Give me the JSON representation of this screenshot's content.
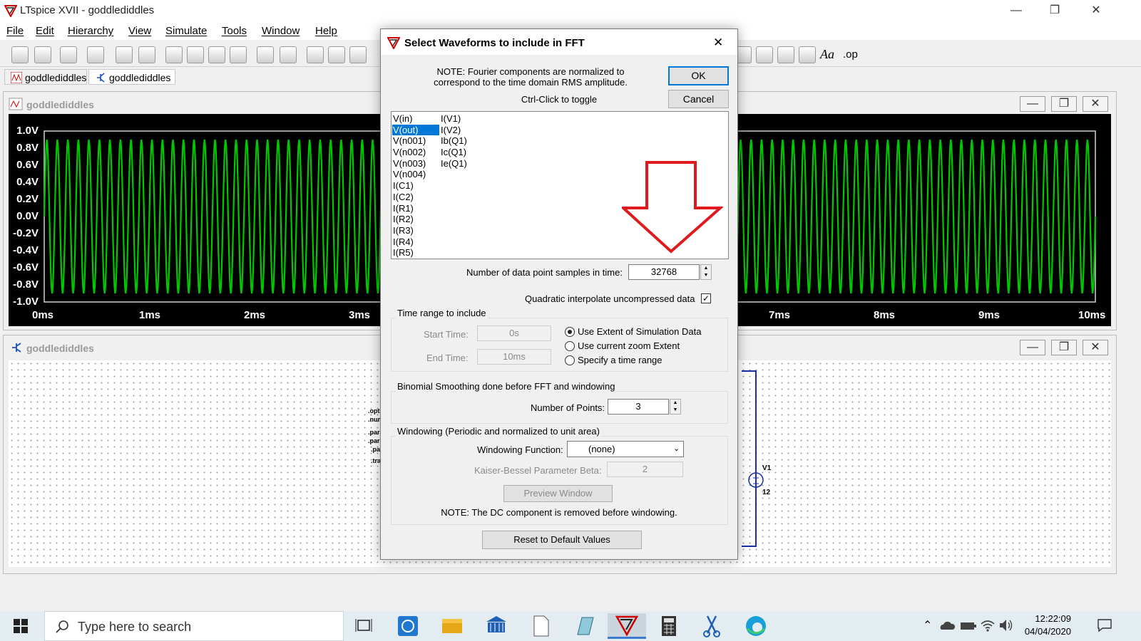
{
  "app": {
    "title": "LTspice XVII - goddlediddles",
    "colors": {
      "trace": "#00c800",
      "plot_bg": "#000000",
      "arrow": "#e0191e",
      "selection": "#0078d7"
    }
  },
  "window_controls": {
    "minimize": "—",
    "restore": "❐",
    "close": "✕"
  },
  "menu": [
    "File",
    "Edit",
    "Hierarchy",
    "View",
    "Simulate",
    "Tools",
    "Window",
    "Help"
  ],
  "toolbar": {
    "right_icons": [
      "Aa",
      ".op"
    ]
  },
  "tabs": [
    {
      "label": "goddlediddles",
      "icon": "waveform-icon"
    },
    {
      "label": "goddlediddles",
      "icon": "schematic-icon"
    }
  ],
  "plot_window": {
    "title": "goddlediddles",
    "y_ticks": [
      "1.0V",
      "0.8V",
      "0.6V",
      "0.4V",
      "0.2V",
      "0.0V",
      "-0.2V",
      "-0.4V",
      "-0.6V",
      "-0.8V",
      "-1.0V"
    ],
    "x_ticks": [
      "0ms",
      "1ms",
      "2ms",
      "3ms",
      "7ms",
      "8ms",
      "9ms",
      "10ms"
    ],
    "controls": [
      "—",
      "❐",
      "✕"
    ]
  },
  "chart_data": {
    "type": "line",
    "series": [
      {
        "amplitude_V": 0.9,
        "cycles_shown": 100
      }
    ],
    "x_range_ms": [
      0,
      10
    ],
    "ylim": [
      -1.0,
      1.0
    ],
    "grid": false
  },
  "schematic_window": {
    "title": "goddlediddles",
    "directives": [
      ".optio",
      ".numd",
      ".para",
      ".para",
      ".para",
      ".tran"
    ],
    "component_labels": [
      "V1",
      "12"
    ],
    "controls": [
      "—",
      "❐",
      "✕"
    ]
  },
  "dialog": {
    "title": "Select Waveforms to include in FFT",
    "close": "✕",
    "note_line1": "NOTE:  Fourier components are normalized to",
    "note_line2": "correspond to the time domain RMS amplitude.",
    "toggle_hint": "Ctrl-Click to toggle",
    "ok": "OK",
    "cancel": "Cancel",
    "waveforms_col1": [
      "V(in)",
      "V(out)",
      "V(n001)",
      "V(n002)",
      "V(n003)",
      "V(n004)",
      "I(C1)",
      "I(C2)",
      "I(R1)",
      "I(R2)",
      "I(R3)",
      "I(R4)",
      "I(R5)"
    ],
    "waveforms_col2": [
      "I(V1)",
      "I(V2)",
      "Ib(Q1)",
      "Ic(Q1)",
      "Ie(Q1)"
    ],
    "selected": "V(out)",
    "samples_label": "Number of data point samples in time:",
    "samples_value": "32768",
    "quadratic_label": "Quadratic interpolate uncompressed data",
    "quadratic_checked": true,
    "time_range": {
      "group_label": "Time range to include",
      "start_label": "Start Time:",
      "start_value": "0s",
      "end_label": "End Time:",
      "end_value": "10ms",
      "options": [
        "Use Extent of Simulation Data",
        "Use current zoom Extent",
        "Specify a time range"
      ],
      "selected_index": 0
    },
    "smoothing": {
      "group_label": "Binomial Smoothing done before FFT and windowing",
      "points_label": "Number of Points:",
      "points_value": "3"
    },
    "windowing": {
      "group_label": "Windowing  (Periodic and normalized to unit area)",
      "function_label": "Windowing Function:",
      "function_value": "(none)",
      "beta_label": "Kaiser-Bessel Parameter Beta:",
      "beta_value": "2",
      "preview": "Preview Window",
      "note": "NOTE:  The DC component is removed before windowing."
    },
    "reset": "Reset to Default Values"
  },
  "taskbar": {
    "search_placeholder": "Type here to search",
    "time": "12:22:09",
    "date": "04/04/2020"
  }
}
